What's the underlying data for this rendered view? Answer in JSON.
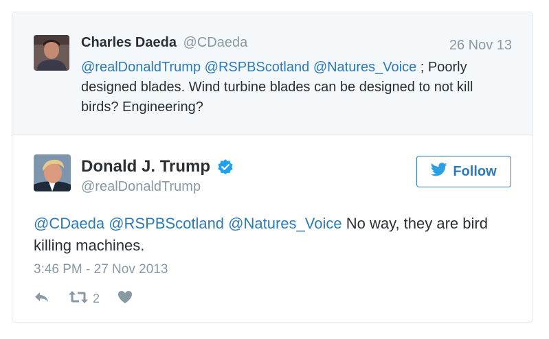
{
  "quoted_tweet": {
    "name": "Charles Daeda",
    "handle": "@CDaeda",
    "date": "26 Nov 13",
    "mentions": [
      "@realDonaldTrump",
      "@RSPBScotland",
      "@Natures_Voice"
    ],
    "text": "; Poorly designed blades. Wind turbine blades can be designed to not kill birds? Engineering?"
  },
  "tweet": {
    "name": "Donald J. Trump",
    "handle": "@realDonaldTrump",
    "follow_label": "Follow",
    "mentions": [
      "@CDaeda",
      "@RSPBScotland",
      "@Natures_Voice"
    ],
    "text": "No way, they are bird killing machines.",
    "timestamp": "3:46 PM - 27 Nov 2013",
    "retweet_count": "2"
  },
  "colors": {
    "link": "#2b7bb9",
    "muted": "#8899a6",
    "verified": "#1da1f2",
    "quoted_bg": "#f5f8fa"
  },
  "icons": {
    "reply": "reply-icon",
    "retweet": "retweet-icon",
    "like": "heart-icon",
    "bird": "twitter-bird-icon",
    "verified": "verified-badge-icon"
  }
}
